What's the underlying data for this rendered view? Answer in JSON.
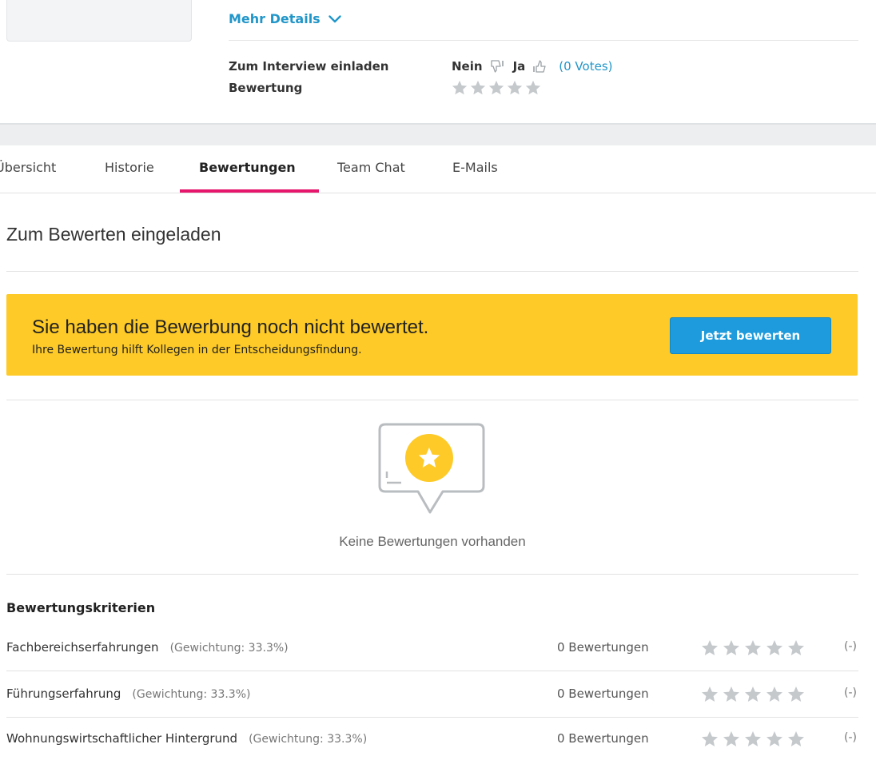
{
  "header": {
    "details_link": "Mehr Details",
    "interview_label": "Zum Interview einladen",
    "rating_label": "Bewertung",
    "no_label": "Nein",
    "yes_label": "Ja",
    "votes_text": "(0 Votes)",
    "rating_stars_filled": 0,
    "rating_stars_total": 5
  },
  "tabs": [
    {
      "label": "Übersicht",
      "active": false
    },
    {
      "label": "Historie",
      "active": false
    },
    {
      "label": "Bewertungen",
      "active": true
    },
    {
      "label": "Team Chat",
      "active": false
    },
    {
      "label": "E-Mails",
      "active": false
    }
  ],
  "section": {
    "title": "Zum Bewerten eingeladen"
  },
  "banner": {
    "title": "Sie haben die Bewerbung noch nicht bewertet.",
    "subtitle": "Ihre Bewertung hilft Kollegen in der Entscheidungsfindung.",
    "button_label": "Jetzt bewerten"
  },
  "empty_state": {
    "text": "Keine Bewertungen vorhanden",
    "icon": "rating-speech-bubble-star-icon"
  },
  "criteria": {
    "title": "Bewertungskriterien",
    "items": [
      {
        "name": "Fachbereichserfahrungen",
        "weight": "(Gewichtung: 33.3%)",
        "count": "0 Bewertungen",
        "result": "(-)",
        "stars_filled": 0
      },
      {
        "name": "Führungserfahrung",
        "weight": "(Gewichtung: 33.3%)",
        "count": "0 Bewertungen",
        "result": "(-)",
        "stars_filled": 0
      },
      {
        "name": "Wohnungswirtschaftlicher Hintergrund",
        "weight": "(Gewichtung: 33.3%)",
        "count": "0 Bewertungen",
        "result": "(-)",
        "stars_filled": 0
      }
    ]
  },
  "colors": {
    "accent_blue": "#2196c9",
    "tab_active": "#e5166c",
    "banner": "#fdca27",
    "button": "#1d9bdc",
    "star_empty": "#c5c9cc"
  }
}
